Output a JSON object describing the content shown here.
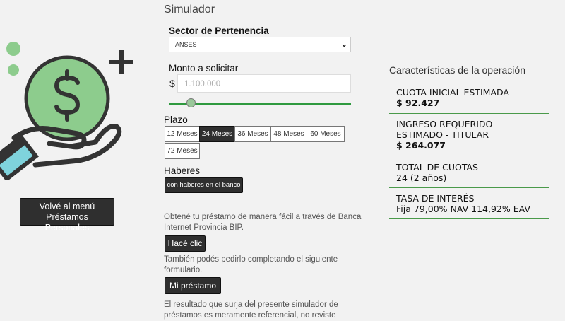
{
  "sidebar": {
    "menu_button_line1": "Volvé al menú",
    "menu_button_line2": "Préstamos Personales"
  },
  "simulator": {
    "title": "Simulador",
    "sector_label": "Sector de Pertenencia",
    "sector_value": "ANSES",
    "monto_label": "Monto a solicitar",
    "currency": "$",
    "monto_placeholder": "1.100.000",
    "slider_fraction": 0.12,
    "plazo_label": "Plazo",
    "terms": [
      "12 Meses",
      "24 Meses",
      "36 Meses",
      "48 Meses",
      "60 Meses",
      "72 Meses"
    ],
    "selected_term": "24 Meses",
    "haberes_label": "Haberes",
    "haberes_button": "con haberes en el banco",
    "info_text_1": "Obtené tu préstamo de manera fácil a través de Banca Internet Provincia BIP.",
    "hace_clic_button": "Hacé clic",
    "info_text_2": "También podés pedirlo completando el siguiente formulario.",
    "mi_prestamo_button": "Mi préstamo",
    "info_text_3": "El resultado que surja del presente simulador de préstamos es meramente referencial, no reviste"
  },
  "operation": {
    "title": "Características de la operación",
    "cuota_label": "CUOTA INICIAL ESTIMADA",
    "cuota_value": "$ 92.427",
    "ingreso_label_1": "INGRESO REQUERIDO",
    "ingreso_label_2": "ESTIMADO - TITULAR",
    "ingreso_value": "$ 264.077",
    "total_label": "TOTAL DE CUOTAS",
    "total_value": "24 (2 años)",
    "tasa_label": "TASA DE INTERÉS",
    "tasa_value": "Fija 79,00% NAV 114,92% EAV"
  },
  "icons": {
    "illustration": "hand-holding-coin-icon",
    "plus": "plus-icon",
    "dots": "circle-dots-icon"
  },
  "colors": {
    "accent_green": "#2f9a3f",
    "coin_green": "#8dcc8d",
    "dark": "#2f2f2f",
    "cuff_teal": "#7fd3dc"
  }
}
